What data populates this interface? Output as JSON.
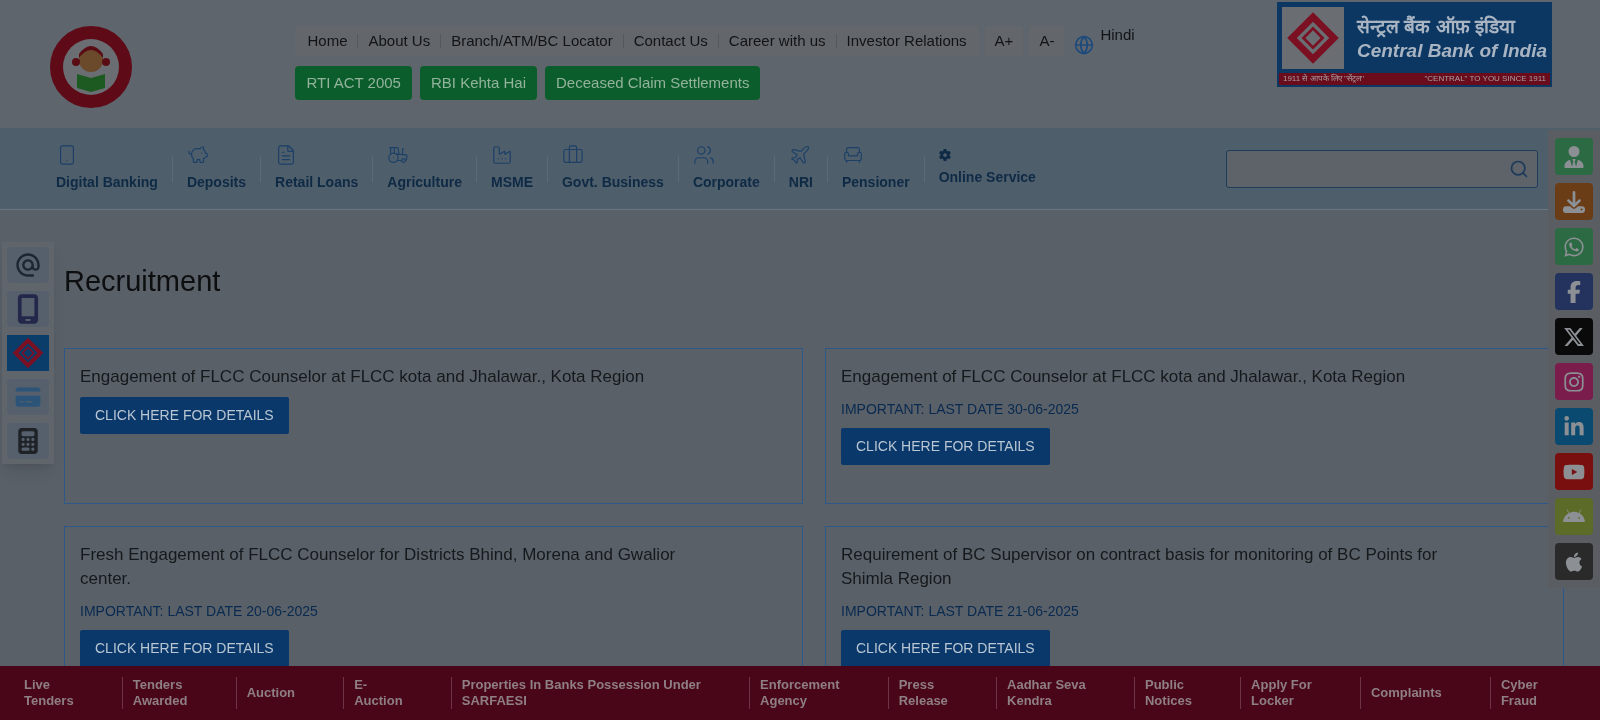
{
  "header": {
    "top_links": [
      "Home",
      "About Us",
      "Branch/ATM/BC Locator",
      "Contact Us",
      "Career with us",
      "Investor Relations"
    ],
    "font_buttons": [
      "A+",
      "A-"
    ],
    "language": "Hindi",
    "quick_buttons": [
      "RTI ACT 2005",
      "RBI Kehta Hai",
      "Deceased Claim Settlements"
    ],
    "logo": {
      "hindi_name": "सेन्ट्रल बैंक ऑफ़ इंडिया",
      "english_name": "Central Bank of India",
      "tagline_hindi": "1911 से आपके लिए ''सेंट्रल''",
      "tagline_english": "\"CENTRAL\" TO YOU SINCE 1911"
    }
  },
  "nav": [
    {
      "label": "Digital Banking"
    },
    {
      "label": "Deposits"
    },
    {
      "label": "Retail Loans"
    },
    {
      "label": "Agriculture"
    },
    {
      "label": "MSME"
    },
    {
      "label": "Govt. Business"
    },
    {
      "label": "Corporate"
    },
    {
      "label": "NRI"
    },
    {
      "label": "Pensioner"
    },
    {
      "label": "Online Service"
    }
  ],
  "page_title": "Recruitment",
  "cards": [
    {
      "title": "Engagement of FLCC Counselor at FLCC kota and Jhalawar., Kota Region",
      "button": "CLICK HERE FOR DETAILS"
    },
    {
      "title": "Engagement of FLCC Counselor at FLCC kota and Jhalawar., Kota Region",
      "important": "IMPORTANT: LAST DATE 30-06-2025",
      "button": "CLICK HERE FOR DETAILS"
    },
    {
      "title": "Fresh Engagement of FLCC Counselor for Districts Bhind, Morena and Gwalior center.",
      "important": "IMPORTANT: LAST DATE 20-06-2025",
      "button": "CLICK HERE FOR DETAILS"
    },
    {
      "title": "Requirement of BC Supervisor on contract basis for monitoring of BC Points for Shimla Region",
      "important": "IMPORTANT: LAST DATE 21-06-2025",
      "button": "CLICK HERE FOR DETAILS"
    }
  ],
  "footer_links": [
    [
      "Live",
      "Tenders"
    ],
    [
      "Tenders",
      "Awarded"
    ],
    [
      "Auction"
    ],
    [
      "E-",
      "Auction"
    ],
    [
      "Properties In Banks Possession Under",
      "SARFAESI"
    ],
    [
      "Enforcement",
      "Agency"
    ],
    [
      "Press",
      "Release"
    ],
    [
      "Aadhar Seva",
      "Kendra"
    ],
    [
      "Public",
      "Notices"
    ],
    [
      "Apply For",
      "Locker"
    ],
    [
      "Complaints"
    ],
    [
      "Cyber",
      "Fraud"
    ]
  ]
}
